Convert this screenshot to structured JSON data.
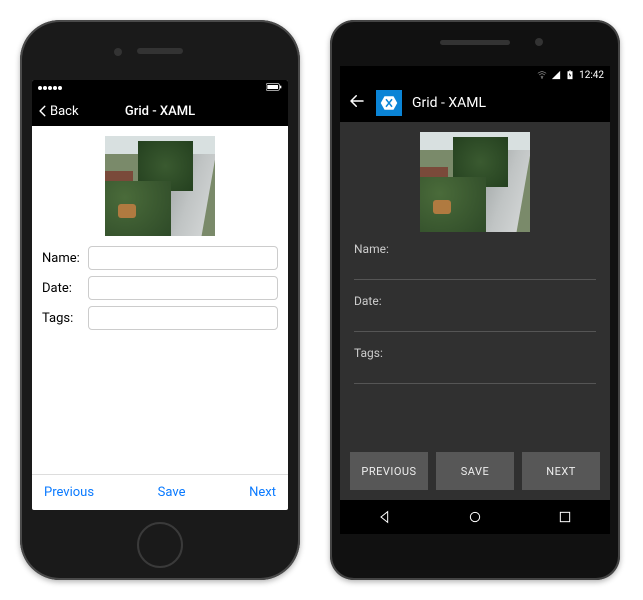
{
  "ios": {
    "nav": {
      "back_label": "Back",
      "title": "Grid - XAML"
    },
    "form": {
      "name_label": "Name:",
      "date_label": "Date:",
      "tags_label": "Tags:",
      "name_value": "",
      "date_value": "",
      "tags_value": ""
    },
    "toolbar": {
      "previous_label": "Previous",
      "save_label": "Save",
      "next_label": "Next"
    }
  },
  "android": {
    "statusbar": {
      "time": "12:42"
    },
    "appbar": {
      "title": "Grid - XAML"
    },
    "form": {
      "name_label": "Name:",
      "date_label": "Date:",
      "tags_label": "Tags:",
      "name_value": "",
      "date_value": "",
      "tags_value": ""
    },
    "toolbar": {
      "previous_label": "PREVIOUS",
      "save_label": "SAVE",
      "next_label": "NEXT"
    }
  }
}
